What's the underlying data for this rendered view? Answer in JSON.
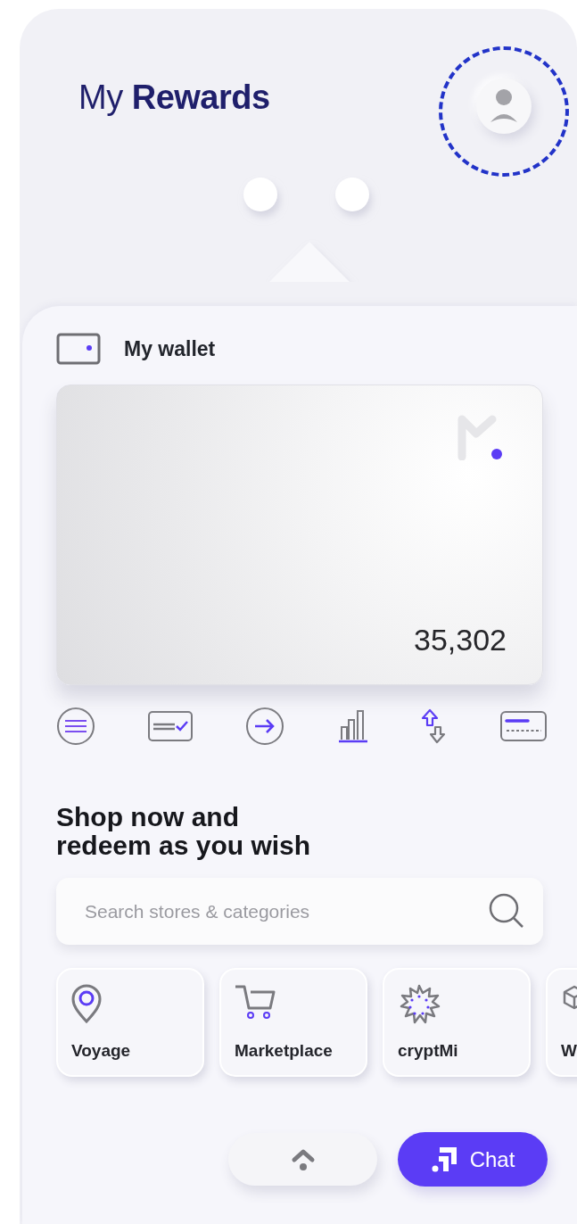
{
  "header": {
    "title": "My **Rewards**",
    "avatar": {
      "highlighted": true
    }
  },
  "wallet": {
    "label": "My wallet",
    "balance": "35,302"
  },
  "actions": [
    {
      "kind": "menu"
    },
    {
      "kind": "verify"
    },
    {
      "kind": "send"
    },
    {
      "kind": "stats"
    },
    {
      "kind": "exchange"
    },
    {
      "kind": "card"
    }
  ],
  "shop": {
    "heading": "Shop now and\nredeem as you wish",
    "search": {
      "placeholder": "Search stores & categories"
    }
  },
  "categories": [
    {
      "kind": "location",
      "label": "Voyage"
    },
    {
      "kind": "cart",
      "label": "Marketplace"
    },
    {
      "kind": "crypto",
      "label": "cryptMi"
    },
    {
      "kind": "cube",
      "label": "W"
    }
  ],
  "bottom_bar": {
    "chat": "Chat"
  }
}
